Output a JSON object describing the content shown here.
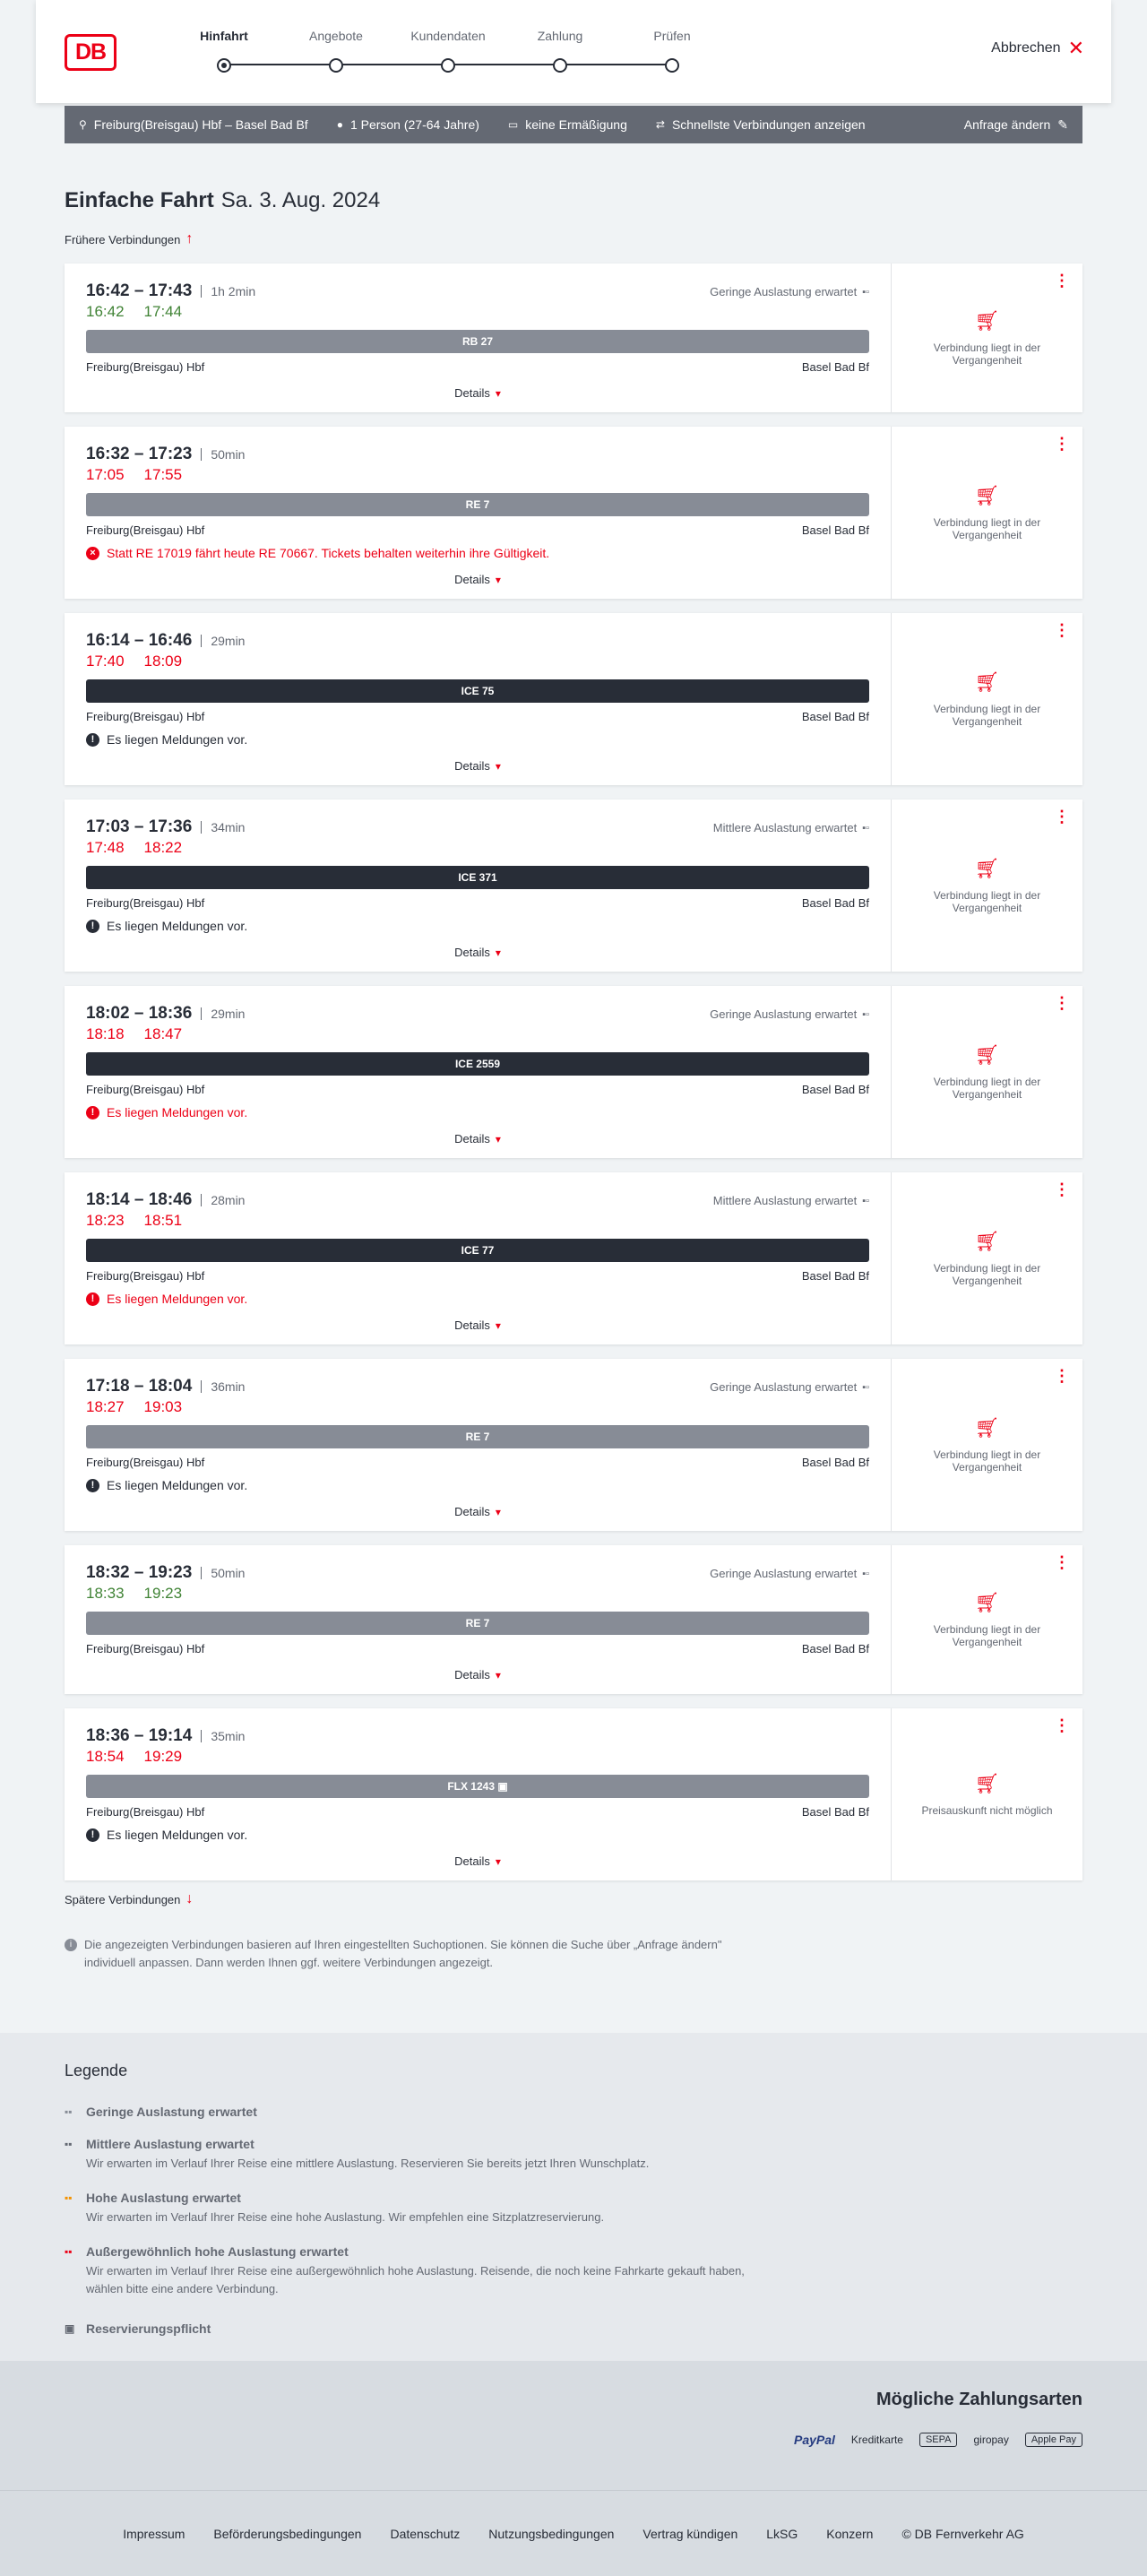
{
  "header": {
    "logo": "DB",
    "steps": [
      {
        "label": "Hinfahrt",
        "active": true
      },
      {
        "label": "Angebote",
        "active": false
      },
      {
        "label": "Kundendaten",
        "active": false
      },
      {
        "label": "Zahlung",
        "active": false
      },
      {
        "label": "Prüfen",
        "active": false
      }
    ],
    "cancel_label": "Abbrechen"
  },
  "search_bar": {
    "route": "Freiburg(Breisgau) Hbf – Basel Bad Bf",
    "passengers": "1 Person (27-64 Jahre)",
    "discount": "keine Ermäßigung",
    "option": "Schnellste Verbindungen anzeigen",
    "change_label": "Anfrage ändern"
  },
  "page": {
    "title": "Einfache Fahrt",
    "date": "Sa. 3. Aug. 2024",
    "earlier_label": "Frühere Verbindungen",
    "later_label": "Spätere Verbindungen",
    "details_label": "Details",
    "info_text": "Die angezeigten Verbindungen basieren auf Ihren eingestellten Suchoptionen. Sie können die Suche über „Anfrage ändern\" individuell anpassen. Dann werden Ihnen ggf. weitere Verbindungen angezeigt."
  },
  "connections": [
    {
      "times": "16:42 – 17:43",
      "duration": "1h 2min",
      "occupancy": "Geringe Auslastung erwartet",
      "rt_dep": "16:42",
      "rt_arr": "17:44",
      "rt_color": "green",
      "train": "RB 27",
      "train_style": "grey",
      "from": "Freiburg(Breisgau) Hbf",
      "to": "Basel Bad Bf",
      "message": "",
      "message_style": "",
      "side_text": "Verbindung liegt in der Vergangenheit"
    },
    {
      "times": "16:32 – 17:23",
      "duration": "50min",
      "occupancy": "",
      "rt_dep": "17:05",
      "rt_arr": "17:55",
      "rt_color": "red",
      "train": "RE 7",
      "train_style": "grey",
      "from": "Freiburg(Breisgau) Hbf",
      "to": "Basel Bad Bf",
      "message": "Statt RE 17019 fährt heute RE 70667. Tickets behalten weiterhin ihre Gültigkeit.",
      "message_style": "red-x",
      "side_text": "Verbindung liegt in der Vergangenheit"
    },
    {
      "times": "16:14 – 16:46",
      "duration": "29min",
      "occupancy": "",
      "rt_dep": "17:40",
      "rt_arr": "18:09",
      "rt_color": "red",
      "train": "ICE 75",
      "train_style": "dark",
      "from": "Freiburg(Breisgau) Hbf",
      "to": "Basel Bad Bf",
      "message": "Es liegen Meldungen vor.",
      "message_style": "black",
      "side_text": "Verbindung liegt in der Vergangenheit"
    },
    {
      "times": "17:03 – 17:36",
      "duration": "34min",
      "occupancy": "Mittlere Auslastung erwartet",
      "rt_dep": "17:48",
      "rt_arr": "18:22",
      "rt_color": "red",
      "train": "ICE 371",
      "train_style": "dark",
      "from": "Freiburg(Breisgau) Hbf",
      "to": "Basel Bad Bf",
      "message": "Es liegen Meldungen vor.",
      "message_style": "black",
      "side_text": "Verbindung liegt in der Vergangenheit"
    },
    {
      "times": "18:02 – 18:36",
      "duration": "29min",
      "occupancy": "Geringe Auslastung erwartet",
      "rt_dep": "18:18",
      "rt_arr": "18:47",
      "rt_color": "red",
      "train": "ICE 2559",
      "train_style": "dark",
      "from": "Freiburg(Breisgau) Hbf",
      "to": "Basel Bad Bf",
      "message": "Es liegen Meldungen vor.",
      "message_style": "red",
      "side_text": "Verbindung liegt in der Vergangenheit"
    },
    {
      "times": "18:14 – 18:46",
      "duration": "28min",
      "occupancy": "Mittlere Auslastung erwartet",
      "rt_dep": "18:23",
      "rt_arr": "18:51",
      "rt_color": "red",
      "train": "ICE 77",
      "train_style": "dark",
      "from": "Freiburg(Breisgau) Hbf",
      "to": "Basel Bad Bf",
      "message": "Es liegen Meldungen vor.",
      "message_style": "red",
      "side_text": "Verbindung liegt in der Vergangenheit"
    },
    {
      "times": "17:18 – 18:04",
      "duration": "36min",
      "occupancy": "Geringe Auslastung erwartet",
      "rt_dep": "18:27",
      "rt_arr": "19:03",
      "rt_color": "red",
      "train": "RE 7",
      "train_style": "grey",
      "from": "Freiburg(Breisgau) Hbf",
      "to": "Basel Bad Bf",
      "message": "Es liegen Meldungen vor.",
      "message_style": "black",
      "side_text": "Verbindung liegt in der Vergangenheit"
    },
    {
      "times": "18:32 – 19:23",
      "duration": "50min",
      "occupancy": "Geringe Auslastung erwartet",
      "rt_dep": "18:33",
      "rt_arr": "19:23",
      "rt_color": "green",
      "train": "RE 7",
      "train_style": "grey",
      "from": "Freiburg(Breisgau) Hbf",
      "to": "Basel Bad Bf",
      "message": "",
      "message_style": "",
      "side_text": "Verbindung liegt in der Vergangenheit"
    },
    {
      "times": "18:36 – 19:14",
      "duration": "35min",
      "occupancy": "",
      "rt_dep": "18:54",
      "rt_arr": "19:29",
      "rt_color": "red",
      "train": "FLX 1243",
      "train_style": "grey",
      "train_reservation": true,
      "from": "Freiburg(Breisgau) Hbf",
      "to": "Basel Bad Bf",
      "message": "Es liegen Meldungen vor.",
      "message_style": "black",
      "side_text": "Preisauskunft nicht möglich"
    }
  ],
  "legend": {
    "title": "Legende",
    "items": [
      {
        "title": "Geringe Auslastung erwartet",
        "desc": "",
        "icon_color": "#878c96"
      },
      {
        "title": "Mittlere Auslastung erwartet",
        "desc": "Wir erwarten im Verlauf Ihrer Reise eine mittlere Auslastung. Reservieren Sie bereits jetzt Ihren Wunschplatz.",
        "icon_color": "#646973"
      },
      {
        "title": "Hohe Auslastung erwartet",
        "desc": "Wir erwarten im Verlauf Ihrer Reise eine hohe Auslastung. Wir empfehlen eine Sitzplatzreservierung.",
        "icon_color": "#f39200"
      },
      {
        "title": "Außergewöhnlich hohe Auslastung erwartet",
        "desc": "Wir erwarten im Verlauf Ihrer Reise eine außergewöhnlich hohe Auslastung. Reisende, die noch keine Fahrkarte gekauft haben, wählen bitte eine andere Verbindung.",
        "icon_color": "#ec0016"
      },
      {
        "title": "Reservierungspflicht",
        "desc": "",
        "icon_color": "#646973"
      }
    ]
  },
  "payment": {
    "title": "Mögliche Zahlungsarten",
    "methods": [
      "PayPal",
      "Kreditkarte",
      "SEPA",
      "giropay",
      "Apple Pay"
    ]
  },
  "footer": {
    "links": [
      "Impressum",
      "Beförderungsbedingungen",
      "Datenschutz",
      "Nutzungsbedingungen",
      "Vertrag kündigen",
      "LkSG",
      "Konzern",
      "© DB Fernverkehr AG"
    ]
  }
}
